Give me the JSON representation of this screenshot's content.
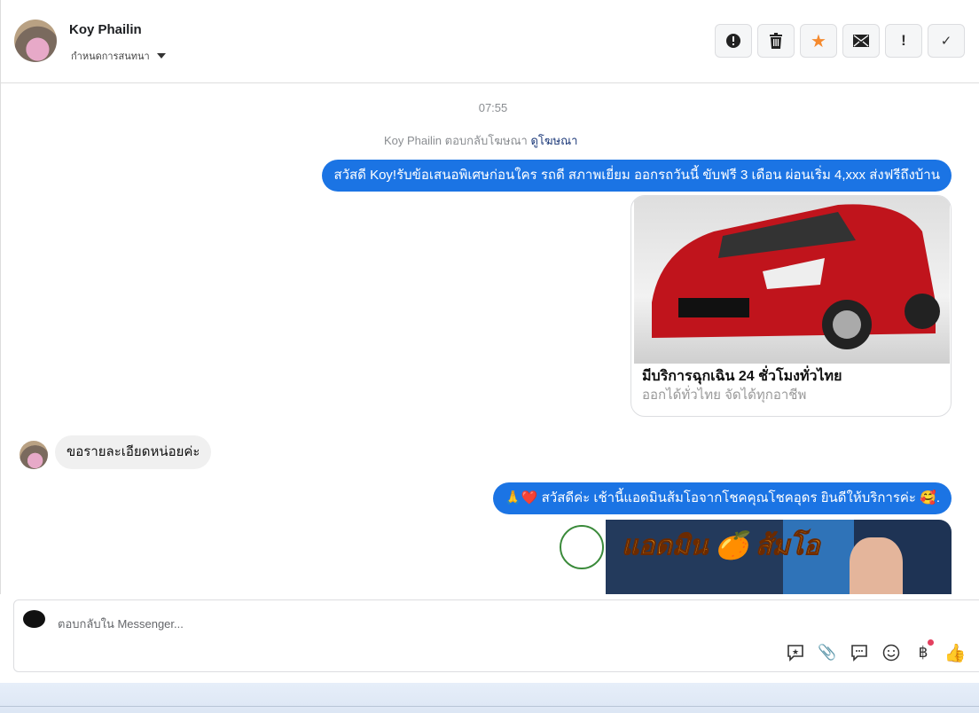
{
  "header": {
    "name": "Koy Phailin",
    "assign_label": "กำหนดการสนทนา",
    "actions": [
      {
        "icon": "alert-circle-icon",
        "glyph": "⬤"
      },
      {
        "icon": "trash-icon",
        "glyph": "🗑"
      },
      {
        "icon": "star-icon",
        "glyph": "★"
      },
      {
        "icon": "envelope-icon",
        "glyph": "✉"
      },
      {
        "icon": "exclamation-icon",
        "glyph": "!"
      },
      {
        "icon": "check-icon",
        "glyph": "✓"
      }
    ],
    "star_color": "#f58a2e"
  },
  "chat": {
    "time": "07:55",
    "ad_reply": "Koy Phailin ตอบกลับโฆษณา",
    "ad_link": "ดูโฆษณา",
    "message1": "สวัสดี Koy!รับข้อเสนอพิเศษก่อนใคร รถดี สภาพเยี่ยม ออกรถวันนี้ ขับฟรี 3 เดือน ผ่อนเริ่ม 4,xxx ส่งฟรีถึงบ้าน",
    "card": {
      "title": "มีบริการฉุกเฉิน 24 ชั่วโมงทั่วไทย",
      "subtitle": "ออกได้ทั่วไทย จัดได้ทุกอาชีพ"
    },
    "incoming": "ขอรายละเอียดหน่อยค่ะ",
    "message2": "🙏❤️ สวัสดีค่ะ เช้านี้แอดมินส้มโอจากโชคคุณโชคอุดร ยินดีให้บริการค่ะ 🥰.",
    "banner_text": "แอดมิน 🍊 ส้มโอ",
    "bubble_color": "#1b74e4"
  },
  "composer": {
    "placeholder": "ตอบกลับใน Messenger...",
    "tools": [
      "saved-reply-icon",
      "paperclip-icon",
      "chat-dots-icon",
      "emoji-icon",
      "baht-icon",
      "thumbs-up-icon"
    ]
  }
}
